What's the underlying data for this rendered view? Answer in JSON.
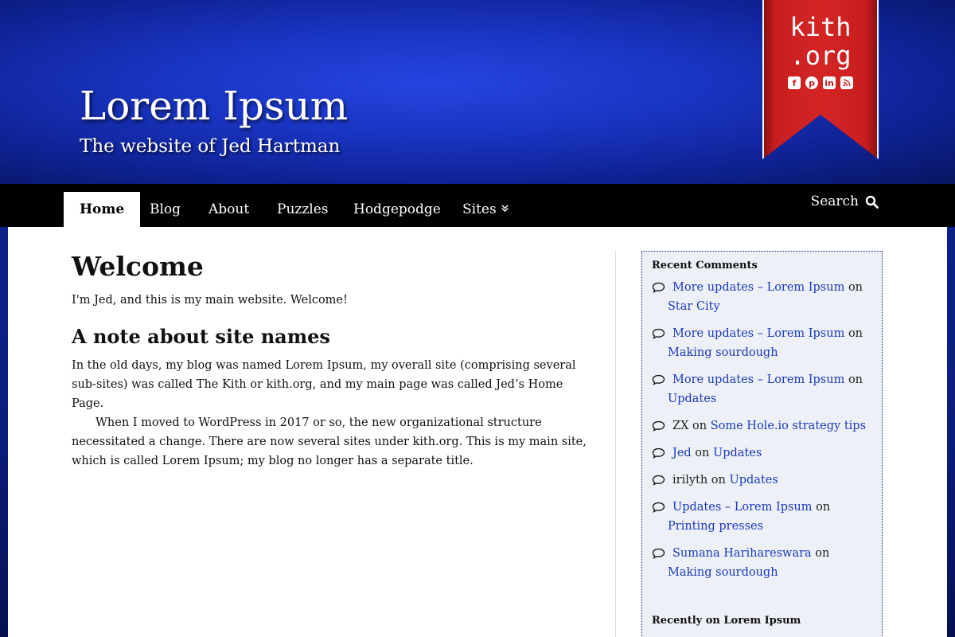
{
  "site": {
    "title": "Lorem Ipsum",
    "tagline": "The website of Jed Hartman"
  },
  "badge": {
    "line1": "kith",
    "line2": ".org",
    "social": [
      "facebook-icon",
      "pinterest-icon",
      "linkedin-icon",
      "rss-icon"
    ]
  },
  "nav": {
    "items": [
      {
        "label": "Home",
        "active": true
      },
      {
        "label": "Blog"
      },
      {
        "label": "About"
      },
      {
        "label": "Puzzles"
      },
      {
        "label": "Hodgepodge"
      },
      {
        "label": "Sites",
        "dropdown": true
      }
    ],
    "search_label": "Search"
  },
  "main": {
    "heading": "Welcome",
    "intro": "I'm Jed, and this is my main website. Welcome!",
    "subheading": "A note about site names",
    "para1": "In the old days, my blog was named Lorem Ipsum, my overall site (comprising several sub-sites) was called The Kith or kith.org, and my main page was called Jed’s Home Page.",
    "para2": "When I moved to WordPress in 2017 or so, the new organizational structure necessitated a change. There are now several sites under kith.org. This is my main site, which is called Lorem Ipsum; my blog no longer has a separate title."
  },
  "sidebar": {
    "recent_comments_title": "Recent Comments",
    "comments": [
      {
        "author": "More updates – Lorem Ipsum",
        "author_link": true,
        "on": "on",
        "post": "Star City"
      },
      {
        "author": "More updates – Lorem Ipsum",
        "author_link": true,
        "on": "on",
        "post": "Making sourdough"
      },
      {
        "author": "More updates – Lorem Ipsum",
        "author_link": true,
        "on": "on",
        "post": "Updates"
      },
      {
        "author": "ZX",
        "author_link": false,
        "on": "on",
        "post": "Some Hole.io strategy tips"
      },
      {
        "author": "Jed",
        "author_link": true,
        "on": "on",
        "post": "Updates"
      },
      {
        "author": "irilyth",
        "author_link": false,
        "on": "on",
        "post": "Updates"
      },
      {
        "author": "Updates – Lorem Ipsum",
        "author_link": true,
        "on": "on",
        "post": "Printing presses"
      },
      {
        "author": "Sumana Harihareswara",
        "author_link": true,
        "on": "on",
        "post": "Making sourdough"
      }
    ],
    "recent_posts_title": "Recently on Lorem Ipsum"
  },
  "colors": {
    "header_blue": "#1a35c4",
    "ribbon_red": "#d42525",
    "link": "#1a3ab8",
    "nav_bg": "#000000"
  }
}
